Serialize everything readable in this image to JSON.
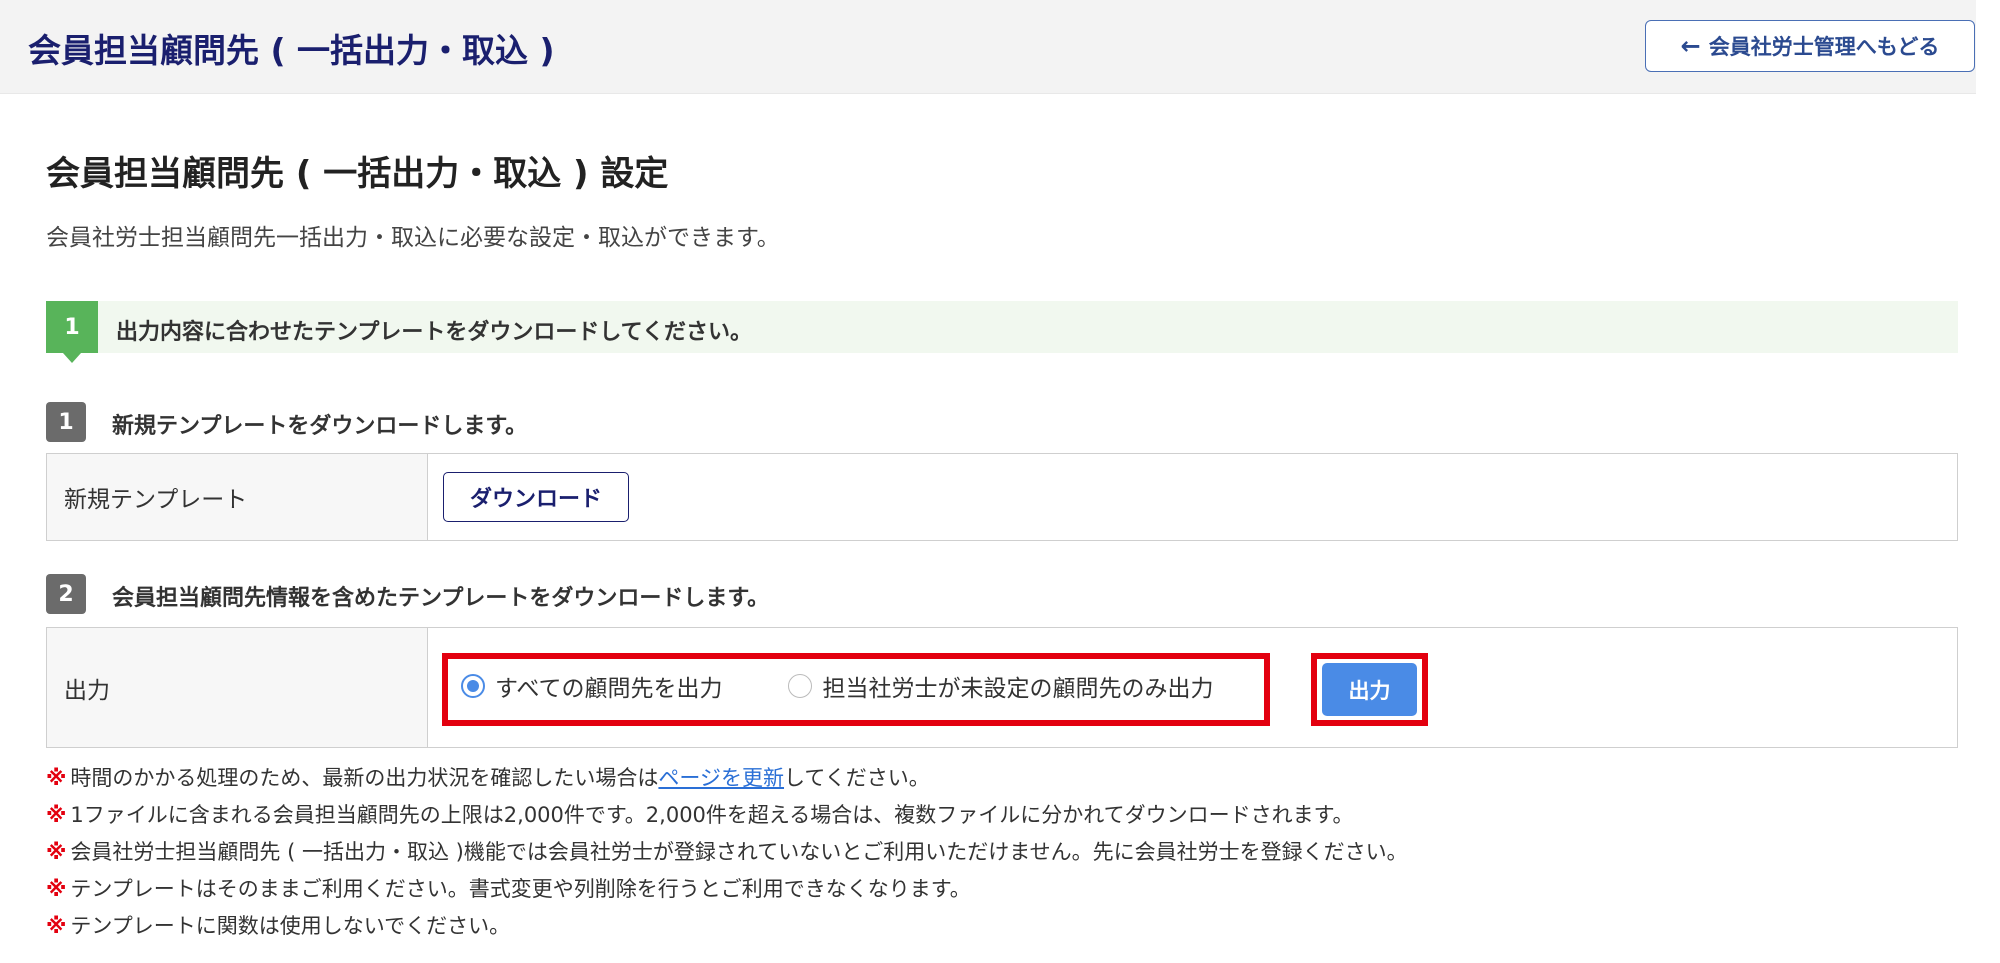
{
  "header": {
    "title": "会員担当顧問先 ( 一括出力・取込 )",
    "back_button": "会員社労士管理へもどる"
  },
  "page": {
    "title": "会員担当顧問先 ( 一括出力・取込 ) 設定",
    "description": "会員社労士担当顧問先一括出力・取込に必要な設定・取込ができます。"
  },
  "step1": {
    "number": "1",
    "text": "出力内容に合わせたテンプレートをダウンロードしてください。"
  },
  "section1": {
    "number": "1",
    "title": "新規テンプレートをダウンロードします。",
    "row_label": "新規テンプレート",
    "download_button": "ダウンロード"
  },
  "section2": {
    "number": "2",
    "title": "会員担当顧問先情報を含めたテンプレートをダウンロードします。",
    "row_label": "出力",
    "options": [
      {
        "label": "すべての顧問先を出力",
        "selected": true
      },
      {
        "label": "担当社労士が未設定の顧問先のみ出力",
        "selected": false
      }
    ],
    "output_button": "出力"
  },
  "notes": {
    "mark": "※",
    "n1_before": "時間のかかる処理のため、最新の出力状況を確認したい場合は",
    "n1_link": "ページを更新",
    "n1_after": "してください。",
    "n2": "1ファイルに含まれる会員担当顧問先の上限は2,000件です。2,000件を超える場合は、複数ファイルに分かれてダウンロードされます。",
    "n3": "会員社労士担当顧問先 ( 一括出力・取込 )機能では会員社労士が登録されていないとご利用いただけません。先に会員社労士を登録ください。",
    "n4": "テンプレートはそのままご利用ください。書式変更や列削除を行うとご利用できなくなります。",
    "n5": "テンプレートに関数は使用しないでください。"
  },
  "colors": {
    "brand_navy": "#1a1f6e",
    "step_green": "#58b45a",
    "primary_blue": "#4a8be6",
    "highlight_red": "#e3000f"
  }
}
